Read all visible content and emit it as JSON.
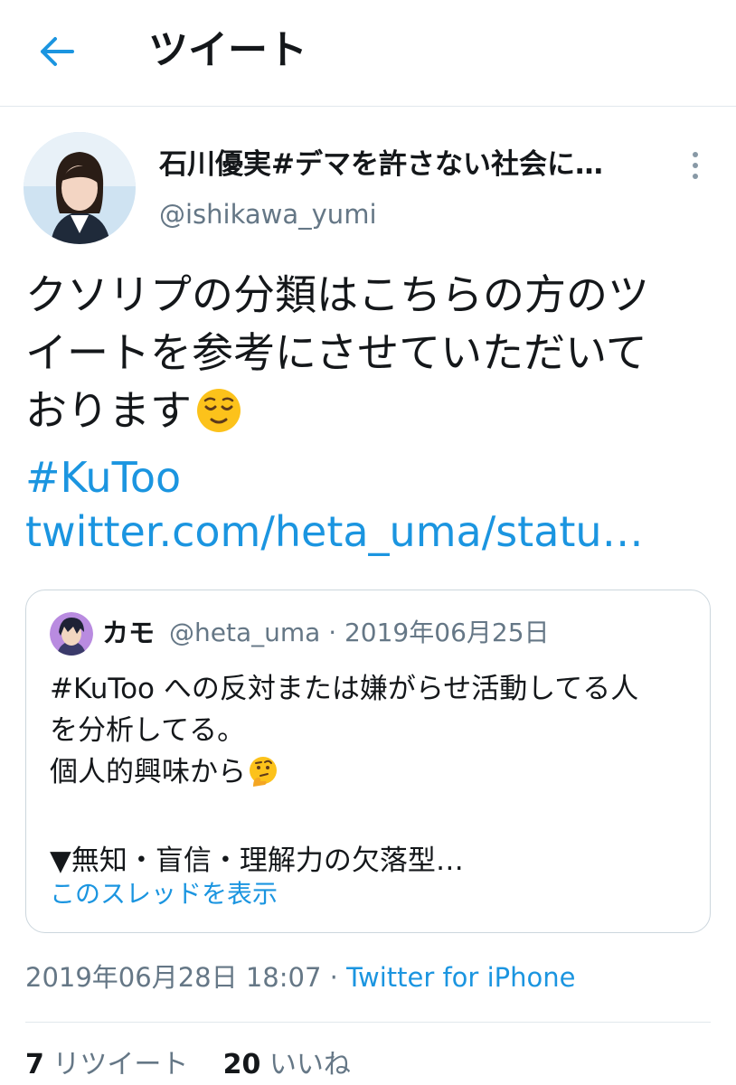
{
  "header": {
    "back_icon": "arrow-left-icon",
    "title": "ツイート",
    "accent_color": "#1b95e0"
  },
  "tweet": {
    "author": {
      "display_name": "石川優実#デマを許さない社会に…",
      "handle": "@ishikawa_yumi"
    },
    "more_icon": "vertical-dots-icon",
    "text_lines": [
      "クソリプの分類はこちらの方のツ",
      "イートを参考にさせていただいて",
      "おります"
    ],
    "text_emoji": "relieved-face-emoji",
    "hashtag": "#KuToo",
    "link": "twitter.com/heta_uma/statu…",
    "quoted": {
      "name": "カモ",
      "handle_date": "@heta_uma · 2019年06月25日",
      "lines": [
        "#KuToo への反対または嫌がらせ活動してる人",
        "を分析してる。",
        "個人的興味から",
        "",
        "▼無知・盲信・理解力の欠落型…"
      ],
      "line3_emoji": "thinking-face-emoji",
      "thread_link": "このスレッドを表示"
    },
    "timestamp": "2019年06月28日 18:07",
    "separator": " · ",
    "source": "Twitter for iPhone",
    "stats": {
      "retweets_count": "7",
      "retweets_label": "リツイート",
      "likes_count": "20",
      "likes_label": "いいね"
    }
  }
}
